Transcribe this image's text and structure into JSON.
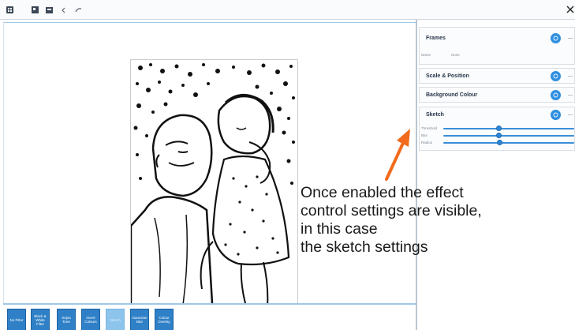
{
  "toolbar": {
    "icons": [
      "grid-icon",
      "image-icon",
      "crop-icon",
      "undo-icon",
      "redo-icon"
    ],
    "close_icon": "close-icon"
  },
  "panel": {
    "frames": {
      "title": "Frames",
      "col_name": "Name",
      "col_value": "None"
    },
    "scale_position": {
      "title": "Scale & Position"
    },
    "background_colour": {
      "title": "Background Colour"
    },
    "sketch": {
      "title": "Sketch",
      "sliders": [
        {
          "label": "Threshold",
          "value": 0.42
        },
        {
          "label": "Blur",
          "value": 0.42
        },
        {
          "label": "Radius",
          "value": 0.43
        }
      ]
    }
  },
  "filters": [
    {
      "label": "No Filter",
      "active": false
    },
    {
      "label": "Black & White Filter",
      "active": false
    },
    {
      "label": "Sepia Tone",
      "active": false
    },
    {
      "label": "Invert Colours",
      "active": false
    },
    {
      "label": "Sketch",
      "active": true
    },
    {
      "label": "Gaussian Blur",
      "active": false
    },
    {
      "label": "Colour Overlay",
      "active": false
    }
  ],
  "callout": {
    "lines": [
      "Once enabled the effect",
      "control settings are visible,",
      "in this case",
      "the sketch settings"
    ]
  },
  "colors": {
    "accent": "#2f80c7",
    "toggle": "#2f8fe0",
    "arrow": "#f26a1b"
  }
}
